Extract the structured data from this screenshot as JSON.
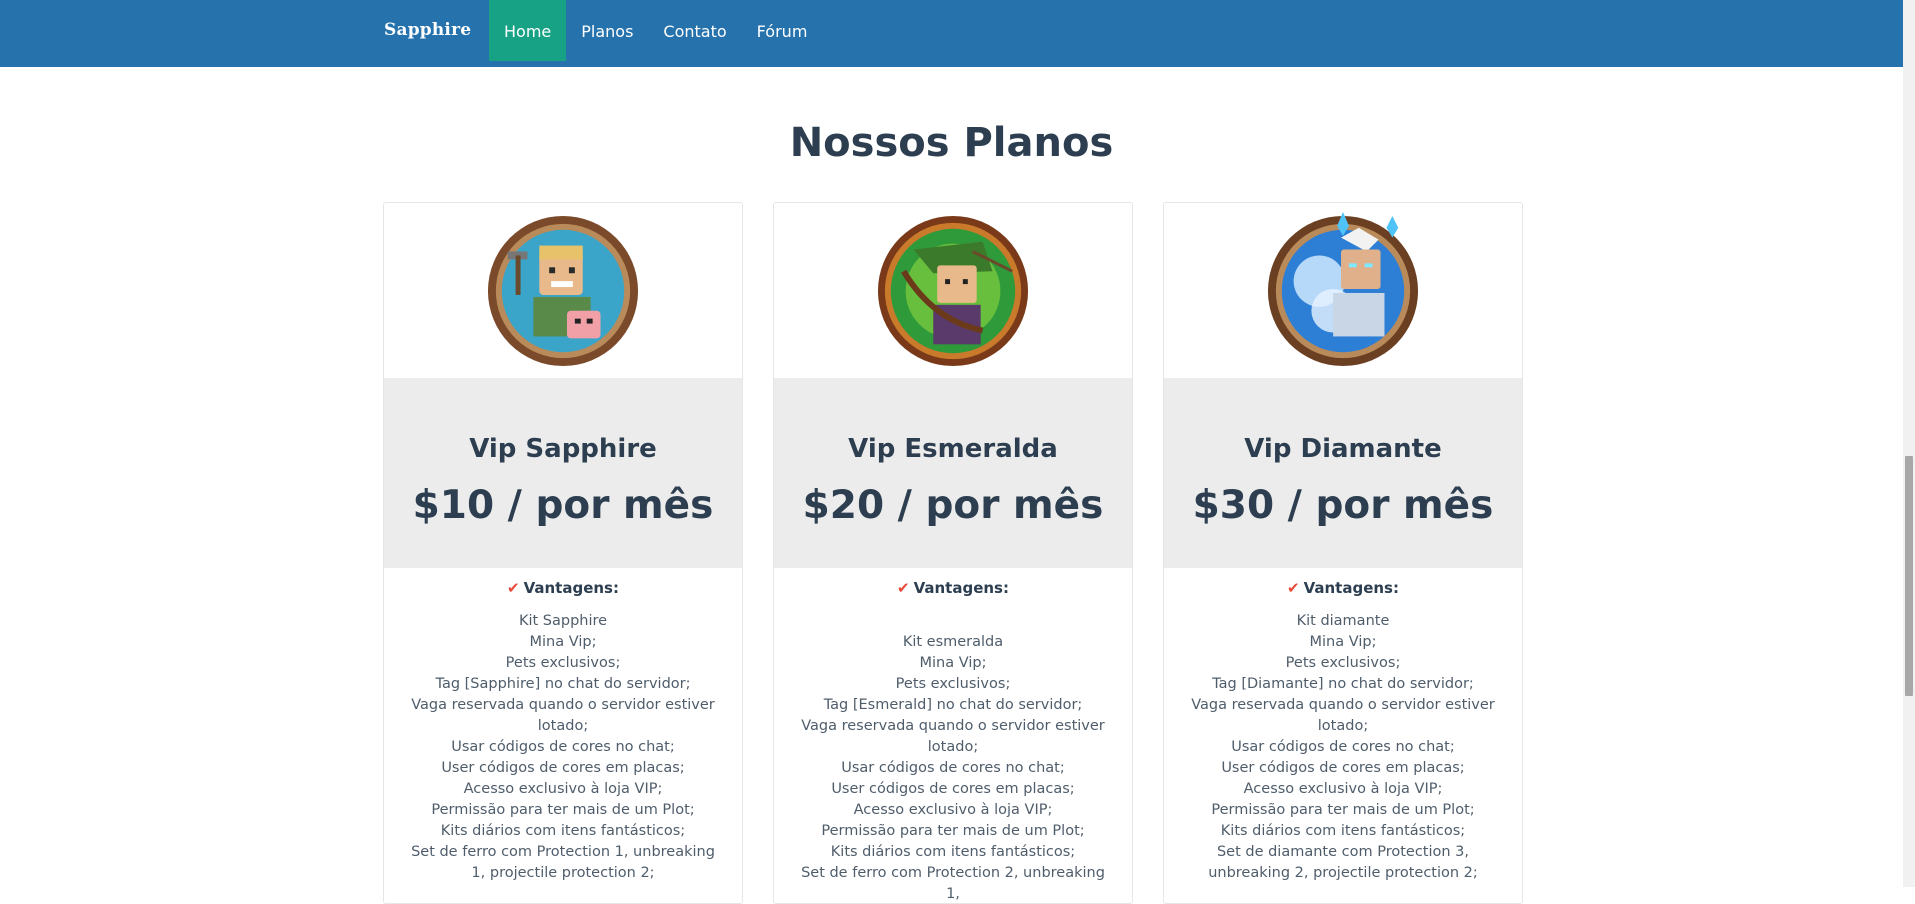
{
  "navbar": {
    "brand": "Sapphire",
    "links": [
      "Home",
      "Planos",
      "Contato",
      "Fórum"
    ],
    "active": "Home",
    "color": "#2572ad",
    "active_color": "#18a285"
  },
  "section": {
    "title": "Nossos Planos"
  },
  "plans": [
    {
      "image": "vip-sapphire-avatar",
      "name": "Vip Sapphire",
      "price": "$10 / por mês",
      "vantagens": "Vantagens:",
      "perks": [
        "Kit Sapphire",
        "Mina Vip;",
        "Pets exclusivos;",
        "Tag [Sapphire] no chat do servidor;",
        "Vaga reservada quando o servidor estiver lotado;",
        "Usar códigos de cores no chat;",
        "User códigos de cores em placas;",
        "Acesso exclusivo à loja VIP;",
        "Permissão para ter mais de um Plot;",
        "Kits diários com itens fantásticos;",
        "Set de ferro com Protection 1, unbreaking 1, projectile protection 2;"
      ]
    },
    {
      "image": "vip-esmeralda-avatar",
      "name": "Vip Esmeralda",
      "price": "$20 / por mês",
      "vantagens": "Vantagens:",
      "perks": [
        "",
        "Kit esmeralda",
        "Mina Vip;",
        "Pets exclusivos;",
        "Tag [Esmerald] no chat do servidor;",
        "Vaga reservada quando o servidor estiver lotado;",
        "Usar códigos de cores no chat;",
        "User códigos de cores em placas;",
        "Acesso exclusivo à loja VIP;",
        "Permissão para ter mais de um Plot;",
        "Kits diários com itens fantásticos;",
        "Set de ferro com Protection 2, unbreaking 1,"
      ]
    },
    {
      "image": "vip-diamante-avatar",
      "name": "Vip Diamante",
      "price": "$30 / por mês",
      "vantagens": "Vantagens:",
      "perks": [
        "Kit diamante",
        "Mina Vip;",
        "Pets exclusivos;",
        "Tag [Diamante] no chat do servidor;",
        "Vaga reservada quando o servidor estiver lotado;",
        "Usar códigos de cores no chat;",
        "User códigos de cores em placas;",
        "Acesso exclusivo à loja VIP;",
        "Permissão para ter mais de um Plot;",
        "Kits diários com itens fantásticos;",
        "Set de diamante com Protection 3, unbreaking 2, projectile protection 2;"
      ]
    }
  ]
}
